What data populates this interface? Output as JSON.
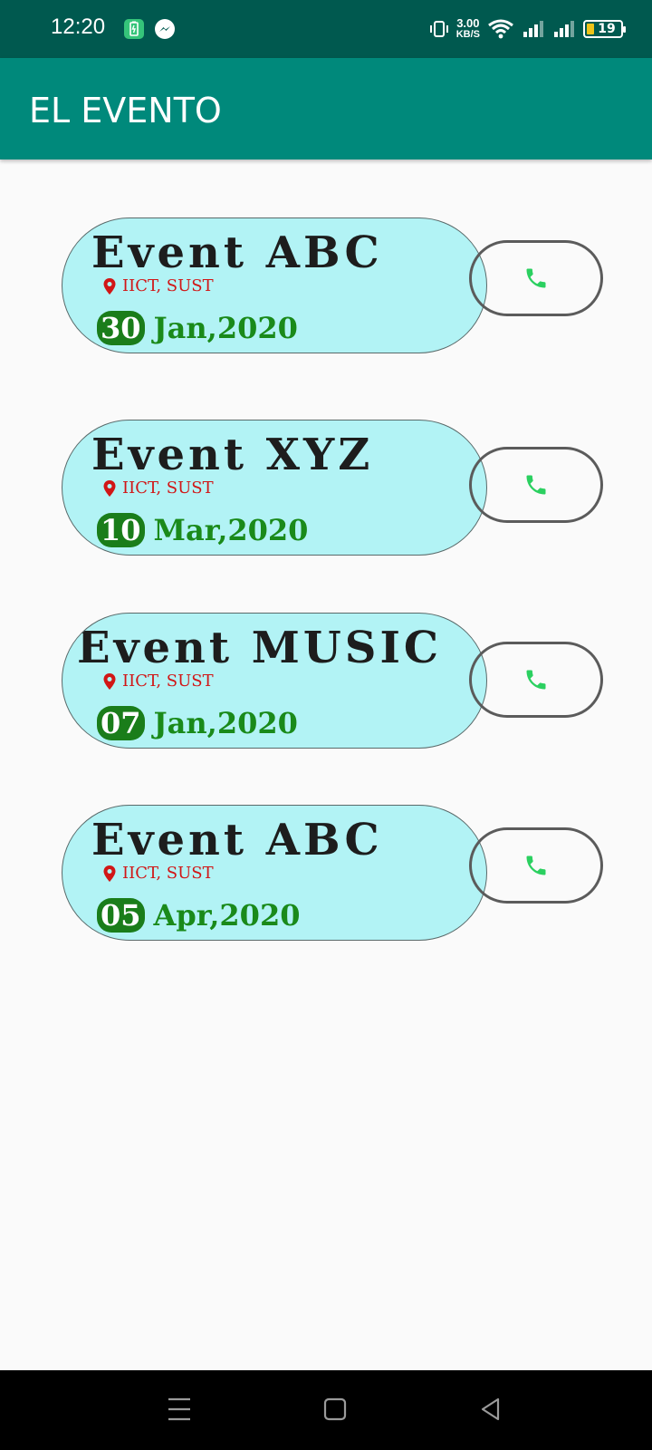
{
  "status_bar": {
    "time": "12:20",
    "net_speed_value": "3.00",
    "net_speed_unit": "KB/S",
    "battery": "19",
    "icons": [
      "battery-saver-icon",
      "messenger-icon",
      "vibrate-icon",
      "wifi-icon",
      "signal-icon",
      "signal-icon",
      "battery-icon"
    ]
  },
  "app_bar": {
    "title": "EL EVENTO"
  },
  "events": [
    {
      "name": "Event ABC",
      "location": "IICT, SUST",
      "day": "30",
      "month_year": "Jan,2020"
    },
    {
      "name": "Event XYZ",
      "location": "IICT, SUST",
      "day": "10",
      "month_year": "Mar,2020"
    },
    {
      "name": "Event MUSIC",
      "location": "IICT, SUST",
      "day": "07",
      "month_year": "Jan,2020"
    },
    {
      "name": "Event ABC",
      "location": "IICT, SUST",
      "day": "05",
      "month_year": "Apr,2020"
    }
  ],
  "colors": {
    "app_bar": "#00897b",
    "status_bar": "#00594f",
    "card_fill": "#b2f3f5",
    "location": "#d11616",
    "date": "#1a8a1a",
    "phone_icon": "#2bd060"
  },
  "nav_bar": {
    "icons": [
      "menu-icon",
      "home-icon",
      "back-icon"
    ]
  }
}
